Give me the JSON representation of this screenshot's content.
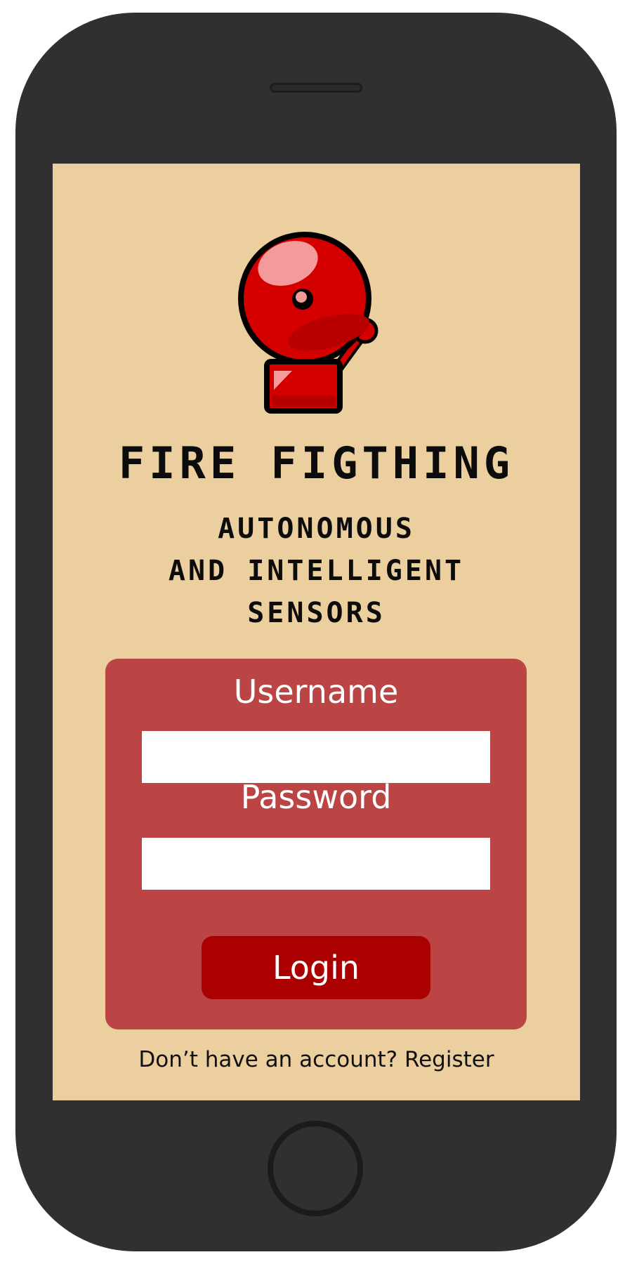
{
  "app": {
    "title": "FIRE FIGTHING",
    "subtitle_lines": [
      "AUTONOMOUS",
      "AND INTELLIGENT",
      "SENSORS"
    ],
    "logo_icon": "fire-alarm-bell-icon"
  },
  "login_form": {
    "username_label": "Username",
    "username_value": "",
    "password_label": "Password",
    "password_value": "",
    "login_label": "Login"
  },
  "footer": {
    "register_text": "Don’t have an account? Register"
  },
  "colors": {
    "screen_bg": "#eccf9e",
    "card_bg": "#bb4444",
    "button_bg": "#aa0000",
    "phone_body": "#303032",
    "bell_red": "#d40000"
  }
}
